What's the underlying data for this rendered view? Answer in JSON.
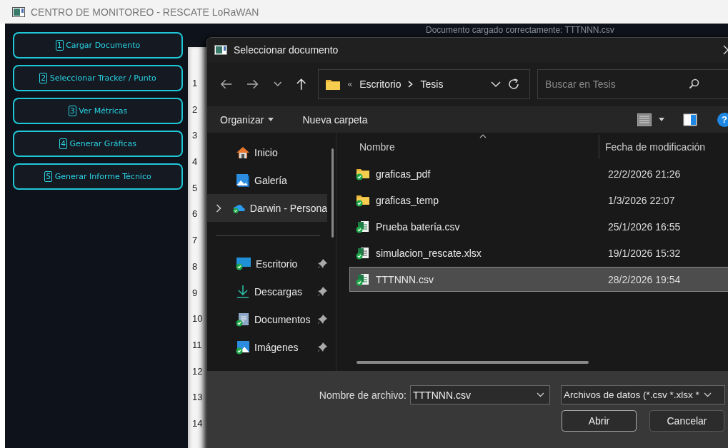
{
  "window": {
    "title": "CENTRO DE MONITOREO - RESCATE LoRaWAN"
  },
  "sidebar": {
    "buttons": [
      {
        "number": "1",
        "label": "Cargar Documento"
      },
      {
        "number": "2",
        "label": "Seleccionar Tracker / Punto"
      },
      {
        "number": "3",
        "label": "Ver Métricas"
      },
      {
        "number": "4",
        "label": "Generar Gráficas"
      },
      {
        "number": "5",
        "label": "Generar Informe Técnico"
      }
    ]
  },
  "status_message": "Documento cargado correctamente: TTTNNN.csv",
  "sheet": {
    "row_numbers": [
      "1",
      "2",
      "3",
      "4",
      "5",
      "6",
      "7",
      "8",
      "9",
      "10",
      "11",
      "12",
      "13",
      "14"
    ]
  },
  "dialog": {
    "title": "Seleccionar documento",
    "breadcrumb_overflow": "«",
    "path": [
      "Escritorio",
      "Tesis"
    ],
    "search": {
      "placeholder": "Buscar en Tesis"
    },
    "toolbar": {
      "organize": "Organizar",
      "new_folder": "Nueva carpeta",
      "help": "?"
    },
    "nav_groups": [
      [
        {
          "label": "Inicio",
          "kind": "home",
          "selected": false,
          "pinned": false,
          "expandable": false
        },
        {
          "label": "Galería",
          "kind": "gallery",
          "selected": false,
          "pinned": false,
          "expandable": false
        },
        {
          "label": "Darwin - Persona",
          "kind": "cloud",
          "selected": true,
          "pinned": false,
          "expandable": true
        }
      ],
      [
        {
          "label": "Escritorio",
          "kind": "desktop",
          "selected": false,
          "pinned": true,
          "expandable": false
        },
        {
          "label": "Descargas",
          "kind": "download",
          "selected": false,
          "pinned": true,
          "expandable": false
        },
        {
          "label": "Documentos",
          "kind": "documents",
          "selected": false,
          "pinned": true,
          "expandable": false
        },
        {
          "label": "Imágenes",
          "kind": "pictures",
          "selected": false,
          "pinned": true,
          "expandable": false
        }
      ]
    ],
    "columns": [
      "Nombre",
      "Fecha de modificación"
    ],
    "files": [
      {
        "name": "graficas_pdf",
        "kind": "folder",
        "modified": "22/2/2026 21:26",
        "selected": false
      },
      {
        "name": "graficas_temp",
        "kind": "folder",
        "modified": "1/3/2026 22:07",
        "selected": false
      },
      {
        "name": "Prueba batería.csv",
        "kind": "csv",
        "modified": "25/1/2026 16:55",
        "selected": false
      },
      {
        "name": "simulacion_rescate.xlsx",
        "kind": "xlsx",
        "modified": "19/1/2026 15:32",
        "selected": false
      },
      {
        "name": "TTTNNN.csv",
        "kind": "csv",
        "modified": "28/2/2026 19:54",
        "selected": true
      }
    ],
    "filename_label": "Nombre de archivo:",
    "filename": "TTTNNN.csv",
    "filter": "Archivos de datos (*.csv *.xlsx *",
    "buttons": [
      "Abrir",
      "Cancelar"
    ]
  }
}
